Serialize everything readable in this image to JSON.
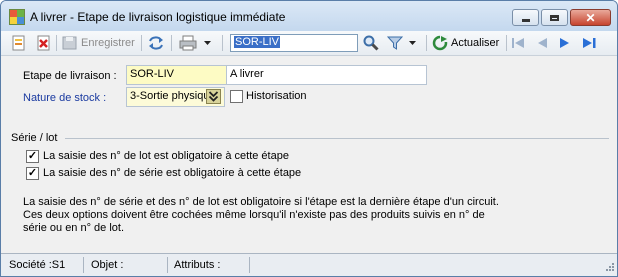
{
  "window": {
    "title": "A livrer -  Etape de livraison logistique immédiate"
  },
  "toolbar": {
    "enregistrer_label": "Enregistrer",
    "search_value": "SOR-LIV",
    "actualiser_label": "Actualiser",
    "icons": [
      "new-icon",
      "delete-icon",
      "save-icon",
      "refresh-arrows-icon",
      "print-icon",
      "dropdown-arrow-icon",
      "search-icon",
      "filter-icon",
      "refresh-icon",
      "first-record-icon",
      "previous-record-icon",
      "next-record-icon",
      "last-record-icon"
    ]
  },
  "form": {
    "etape_label": "Etape de livraison :",
    "etape_code": "SOR-LIV",
    "etape_desc": "A livrer",
    "nature_label": "Nature de stock :",
    "nature_value": "3-Sortie physiqu",
    "historisation_label": "Historisation",
    "historisation_checked": false
  },
  "serie_lot": {
    "section_title": "Série / lot",
    "lot_label": "La saisie des n° de lot est obligatoire à cette étape",
    "lot_checked": true,
    "serie_label": "La saisie des n° de série est obligatoire à cette étape",
    "serie_checked": true,
    "help_line1": "La saisie des n° de série et des n° de lot est obligatoire si l'étape est la dernière étape d'un circuit.",
    "help_line2": "Ces deux options doivent être cochées même lorsqu'il n'existe pas des produits suivis en n° de",
    "help_line3": "série ou en n° de lot."
  },
  "statusbar": {
    "societe": "Société :S1",
    "objet": "Objet :",
    "attributs": "Attributs :"
  },
  "colors": {
    "title_bar": "#c4d8ee",
    "nav_blue": "#2a6fd6",
    "required_field": "#fdfbc4",
    "link_label": "#1a3aa0"
  }
}
